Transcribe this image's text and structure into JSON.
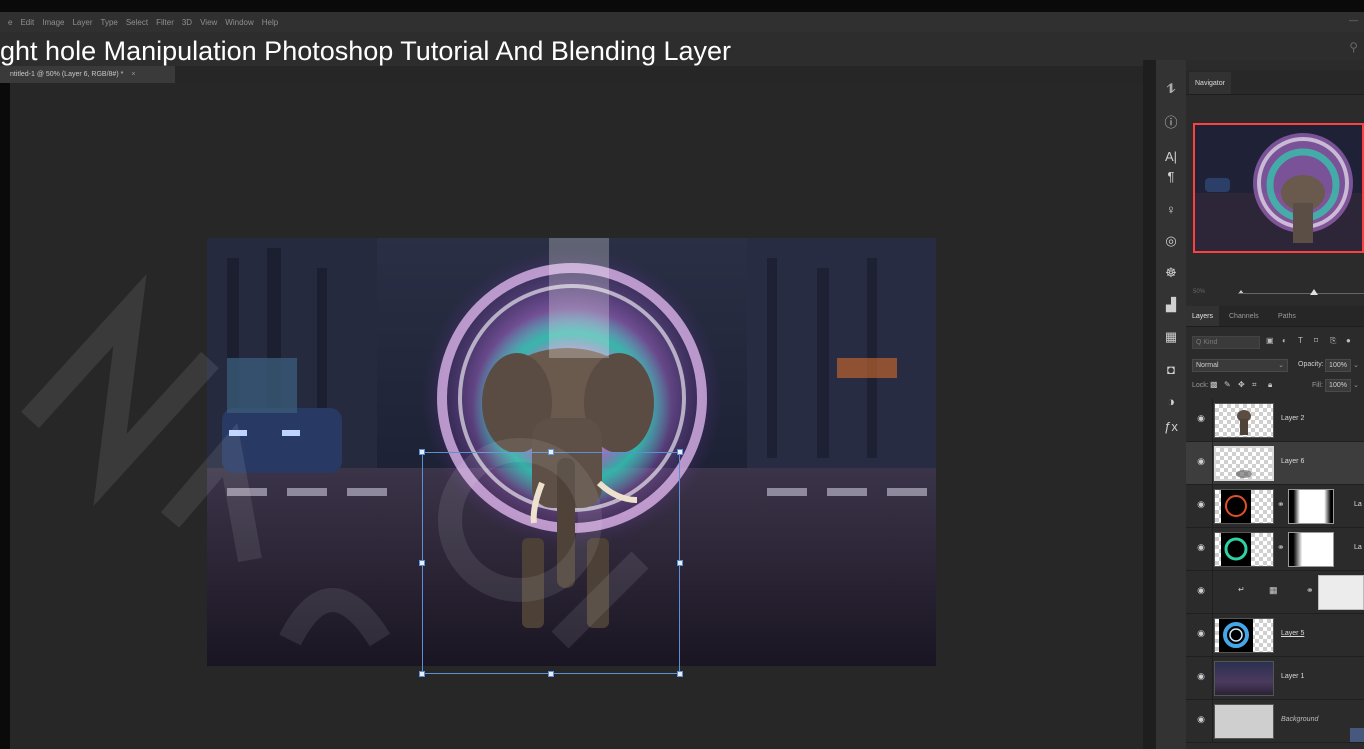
{
  "menubar": {
    "items": [
      "e",
      "Edit",
      "Image",
      "Layer",
      "Type",
      "Select",
      "Filter",
      "3D",
      "View",
      "Window",
      "Help"
    ],
    "window_control": "—"
  },
  "video_title": "ght hole Manipulation Photoshop Tutorial And Blending Layer",
  "document_tab": {
    "title": "ntitled-1 @ 50% (Layer 6, RGB/8#) *",
    "close": "×"
  },
  "panels": {
    "navigator": {
      "tab": "Navigator",
      "zoom_percent": "50%",
      "zoom_level": 0.6
    },
    "layers": {
      "tabs": [
        "Layers",
        "Channels",
        "Paths"
      ],
      "active_tab": "Layers",
      "filter_placeholder": "Q Kind",
      "blend_mode": "Normal",
      "opacity_label": "Opacity:",
      "opacity_value": "100%",
      "lock_label": "Lock:",
      "fill_label": "Fill:",
      "fill_value": "100%",
      "rows": [
        {
          "name": "Layer 2",
          "style": "normal",
          "selected": false
        },
        {
          "name": "Layer 6",
          "style": "normal",
          "selected": true
        },
        {
          "name": "La",
          "style": "normal",
          "selected": false
        },
        {
          "name": "La",
          "style": "normal",
          "selected": false
        },
        {
          "name": "",
          "style": "adjustment",
          "selected": false
        },
        {
          "name": "Layer 5",
          "style": "underline",
          "selected": false
        },
        {
          "name": "Layer 1",
          "style": "normal",
          "selected": false
        },
        {
          "name": "Background",
          "style": "italic",
          "selected": false
        }
      ]
    }
  },
  "icons": {
    "tools": [
      "history-icon",
      "info-icon",
      "character-icon",
      "paragraph-icon",
      "light-bulb-icon",
      "libraries-icon",
      "properties-icon",
      "histogram-icon",
      "swatches-grid-icon",
      "adjustment-icon",
      "color-icon",
      "styles-icon"
    ]
  },
  "colors": {
    "accent_selection": "#5b8fd6",
    "navigator_frame": "#ff4040",
    "panel_bg": "#2b2b2b"
  }
}
